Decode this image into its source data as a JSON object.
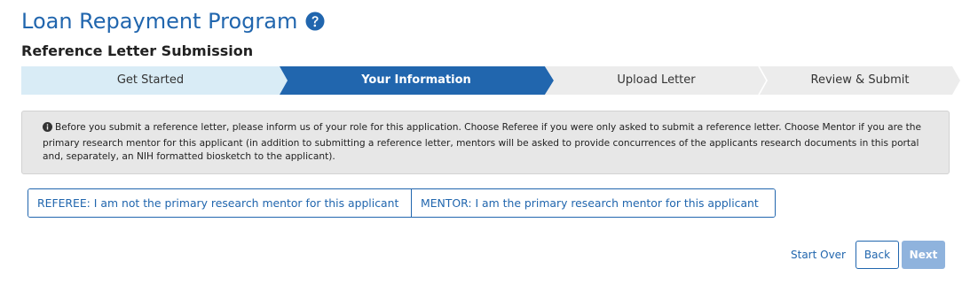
{
  "header": {
    "title": "Loan Repayment Program",
    "help_icon": "question-circle-icon",
    "subtitle": "Reference Letter Submission"
  },
  "stepper": {
    "steps": [
      {
        "label": "Get Started",
        "state": "completed"
      },
      {
        "label": "Your Information",
        "state": "active"
      },
      {
        "label": "Upload Letter",
        "state": "pending"
      },
      {
        "label": "Review & Submit",
        "state": "pending"
      }
    ]
  },
  "info": {
    "icon": "info-circle-icon",
    "text": "Before you submit a reference letter, please inform us of your role for this application. Choose Referee if you were only asked to submit a reference letter. Choose Mentor if you are the primary research mentor for this applicant (in addition to submitting a reference letter, mentors will be asked to provide concurrences of the applicants research documents in this portal and, separately, an NIH formatted biosketch to the applicant)."
  },
  "role": {
    "referee_label": "REFEREE: I am not the primary research mentor for this applicant",
    "mentor_label": "MENTOR: I am the primary research mentor for this applicant"
  },
  "actions": {
    "start_over": "Start Over",
    "back": "Back",
    "next": "Next"
  },
  "colors": {
    "brand_blue": "#2166ae",
    "step_completed": "#d9ecf6",
    "step_pending": "#ececec",
    "next_disabled": "#8fb3dd"
  }
}
